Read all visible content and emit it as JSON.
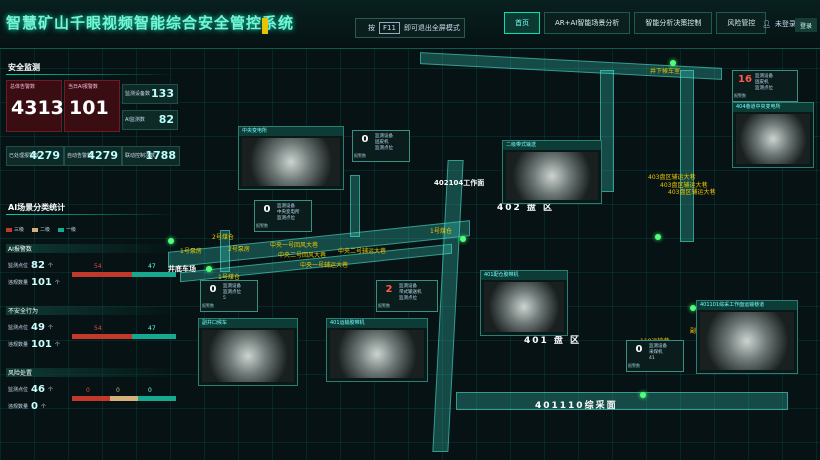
{
  "header": {
    "title": "智慧矿山千眼视频智能综合安全管控系统",
    "fullscreen_hint": {
      "prefix": "按",
      "key": "F11",
      "suffix": "即可退出全屏模式"
    },
    "nav": [
      "首页",
      "AR+AI智能场景分析",
      "智能分析决策控制",
      "风险管控"
    ],
    "user_label": "未登录",
    "logout_label": "登录"
  },
  "monitoring": {
    "section_title": "安全监测",
    "total_alarms_label": "总体告警数",
    "total_alarms": "4313",
    "today_ai_label": "当日AI报警数",
    "today_ai": "101",
    "monitor_devices_label": "监测设备数",
    "monitor_devices": "133",
    "ai_monitor_label": "AI监测数",
    "ai_monitor": "82",
    "handled_label": "已处理报警数",
    "handled": "4279",
    "site_alarm_label": "自动告警数",
    "site_alarm": "4279",
    "linked_label": "联动控制次数",
    "linked": "1788"
  },
  "ai_stats": {
    "section_title": "AI场景分类统计",
    "legend": [
      {
        "label": "三级",
        "color": "#c0392b"
      },
      {
        "label": "二级",
        "color": "#d4b07a"
      },
      {
        "label": "一级",
        "color": "#17a890"
      }
    ],
    "categories": [
      {
        "name": "AI报警数",
        "monitor_label": "监测点位",
        "monitor_value": "82",
        "monitor_unit": "个",
        "violation_label": "违规数量",
        "violation_value": "101",
        "violation_unit": "个",
        "red": 54,
        "tan": 0,
        "teal": 47
      },
      {
        "name": "不安全行为",
        "monitor_label": "监测点位",
        "monitor_value": "49",
        "monitor_unit": "个",
        "violation_label": "违规数量",
        "violation_value": "101",
        "violation_unit": "个",
        "red": 54,
        "tan": 0,
        "teal": 47
      },
      {
        "name": "风险处置",
        "monitor_label": "监测点位",
        "monitor_value": "46",
        "monitor_unit": "个",
        "violation_label": "违规数量",
        "violation_value": "0",
        "violation_unit": "个",
        "red": 0,
        "tan": 0,
        "teal": 0
      }
    ]
  },
  "cameras": [
    {
      "title": "中央变电所"
    },
    {
      "title": "二级带式输送"
    },
    {
      "title": "401配仓胶带机"
    },
    {
      "title": "401101综采工作面运输巷道"
    },
    {
      "title": "401运输胶带机"
    },
    {
      "title": "404巷道中央变电所"
    },
    {
      "title": "副井口候车"
    },
    {
      "title": "401盘区辅助运输大巷"
    }
  ],
  "sensors": [
    {
      "count": "0",
      "count_label": "报警数",
      "items": [
        "监测设备",
        "中央变电所",
        "监测点位"
      ]
    },
    {
      "count": "0",
      "count_label": "报警数",
      "items": [
        "监测设备",
        "固皮机",
        "监测点位"
      ]
    },
    {
      "count": "0",
      "count_label": "报警数",
      "items": [
        "监测设备",
        "监测点位",
        "5"
      ]
    },
    {
      "count": "2",
      "count_label": "报警数",
      "items": [
        "监测设备",
        "带式输送机",
        "监测点位"
      ]
    },
    {
      "count": "16",
      "count_label": "报警数",
      "items": [
        "监测设备",
        "固皮机",
        "监测点位"
      ]
    },
    {
      "count": "0",
      "count_label": "报警数",
      "items": [
        "监测设备",
        "采煤机",
        "41"
      ]
    }
  ],
  "map_labels": {
    "area_402_face": "402104工作面",
    "area_402": "402 盘 区",
    "area_401": "401 盘 区",
    "face_401110": "401110综采面",
    "area_403": "403盘区辅运大巷",
    "area_403b": "403盘区辅运大巷",
    "area_403c": "403盘区辅运大巷",
    "coal_2": "2号煤仓",
    "coal_1": "1号煤仓",
    "pump_1": "1号泵房",
    "pump_2": "2号泵房",
    "ops_center": "井底车场",
    "track_a": "中央一号回风大巷",
    "track_b": "中央二号回风大巷",
    "track_c": "中央一号辅运大巷",
    "track_d": "中央二号辅运大巷",
    "shaft_label": "副井口",
    "tag_110": "110运输巷",
    "tag_1": "1号煤仓",
    "tag_mine": "井下候车室"
  },
  "colors": {
    "accent": "#00e0b0",
    "alarm_red": "#c0392b",
    "warning_yellow": "#f0c800"
  }
}
